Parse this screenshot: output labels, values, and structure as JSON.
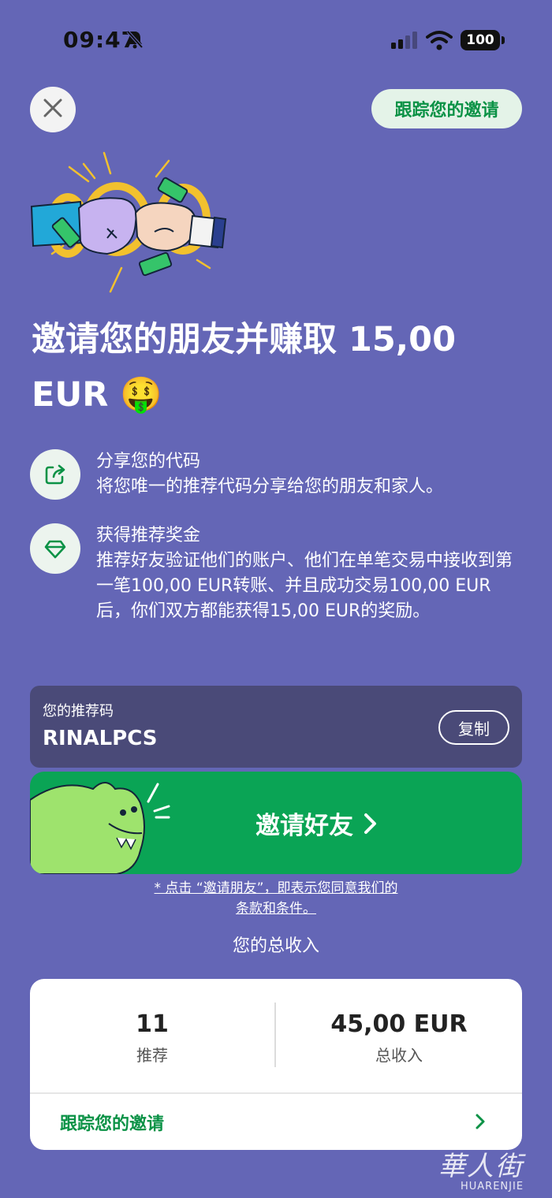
{
  "status_bar": {
    "time": "09:47",
    "battery": "100",
    "icons": [
      "bell-slash-icon",
      "signal-icon",
      "wifi-icon",
      "battery-icon"
    ]
  },
  "header": {
    "close_icon": "close-icon",
    "track_button": "跟踪您的邀请"
  },
  "headline": "邀请您的朋友并赚取 15,00 EUR 🤑",
  "steps": [
    {
      "icon": "share-icon",
      "title": "分享您的代码",
      "description": "将您唯一的推荐代码分享给您的朋友和家人。"
    },
    {
      "icon": "diamond-icon",
      "title": "获得推荐奖金",
      "description": "推荐好友验证他们的账户、他们在单笔交易中接收到第一笔100,00 EUR转账、并且成功交易100,00 EUR后，你们双方都能获得15,00 EUR的奖励。"
    }
  ],
  "referral_code": {
    "label": "您的推荐码",
    "value": "RINALPCS",
    "copy_button": "复制"
  },
  "invite_button": {
    "label": "邀请好友"
  },
  "terms": {
    "line1": "* 点击 “邀请朋友”，即表示您同意我们的",
    "line2": "条款和条件。"
  },
  "earnings": {
    "title": "您的总收入",
    "referrals_value": "11",
    "referrals_label": "推荐",
    "income_value": "45,00 EUR",
    "income_label": "总收入",
    "track_link": "跟踪您的邀请"
  },
  "watermark": {
    "chinese": "華人街",
    "latin": "HUARENJIE"
  },
  "colors": {
    "background": "#6466b6",
    "accent_green": "#0aa455",
    "code_box": "#4a4a78"
  }
}
